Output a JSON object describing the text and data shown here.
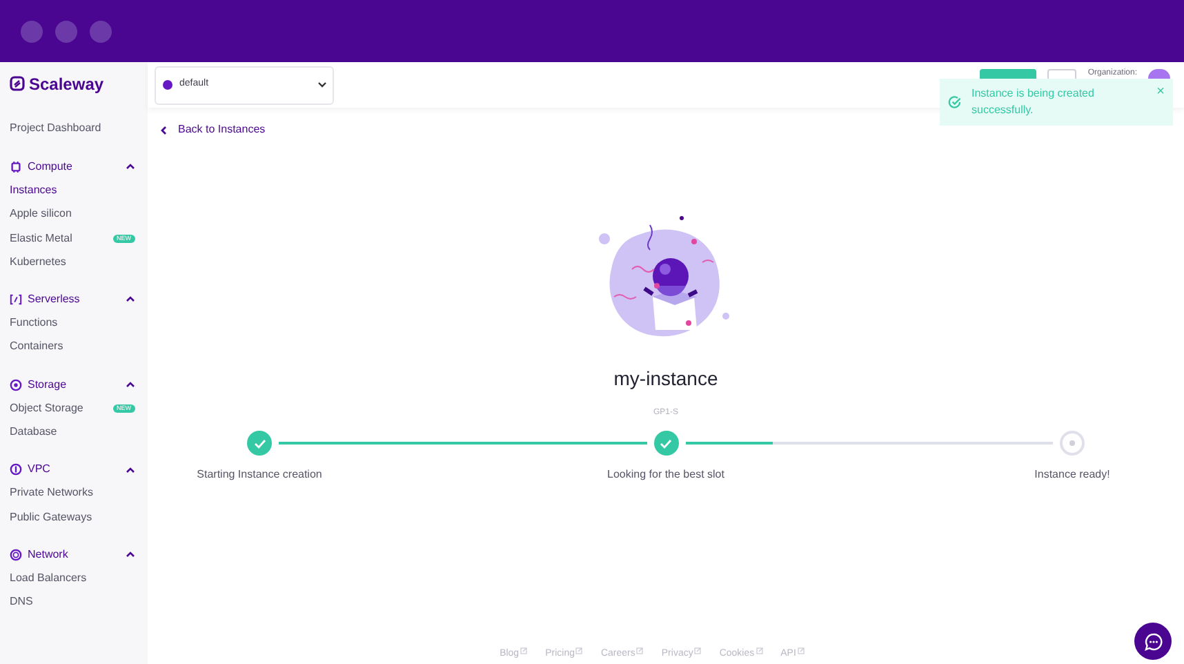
{
  "brand": "Scaleway",
  "project_selector": {
    "value": "default"
  },
  "header": {
    "organization_label": "Organization:"
  },
  "toast": {
    "message": "Instance is being created successfully.",
    "close": "×"
  },
  "sidebar": {
    "items": [
      {
        "kind": "link",
        "label": "Project Dashboard",
        "selected": false
      },
      {
        "kind": "section",
        "label": "Compute",
        "expanded": true,
        "children": [
          {
            "label": "Instances",
            "selected": true
          },
          {
            "label": "Apple silicon",
            "selected": false
          },
          {
            "label": "Elastic Metal",
            "selected": false,
            "badge": "NEW"
          },
          {
            "label": "Kubernetes",
            "selected": false
          }
        ]
      },
      {
        "kind": "section",
        "label": "Serverless",
        "expanded": true,
        "children": [
          {
            "label": "Functions",
            "selected": false
          },
          {
            "label": "Containers",
            "selected": false
          }
        ]
      },
      {
        "kind": "section",
        "label": "Storage",
        "expanded": true,
        "children": [
          {
            "label": "Object Storage",
            "selected": false,
            "badge": "NEW"
          },
          {
            "label": "Database",
            "selected": false
          }
        ]
      },
      {
        "kind": "section",
        "label": "VPC",
        "expanded": true,
        "children": [
          {
            "label": "Private Networks",
            "selected": false
          },
          {
            "label": "Public Gateways",
            "selected": false
          }
        ]
      },
      {
        "kind": "section",
        "label": "Network",
        "expanded": true,
        "children": [
          {
            "label": "Load Balancers",
            "selected": false
          },
          {
            "label": "DNS",
            "selected": false
          }
        ]
      }
    ]
  },
  "back_link": "Back to Instances",
  "instance": {
    "name": "my-instance",
    "type": "GP1-S"
  },
  "steps": [
    {
      "label": "Starting Instance creation",
      "done": true,
      "level": 1
    },
    {
      "label": "Looking for the best slot",
      "done": true,
      "level": 0.24
    },
    {
      "label": "Instance ready!",
      "done": false
    }
  ],
  "footer_links": [
    "Blog",
    "Pricing",
    "Careers",
    "Privacy",
    "Cookies",
    "API"
  ]
}
